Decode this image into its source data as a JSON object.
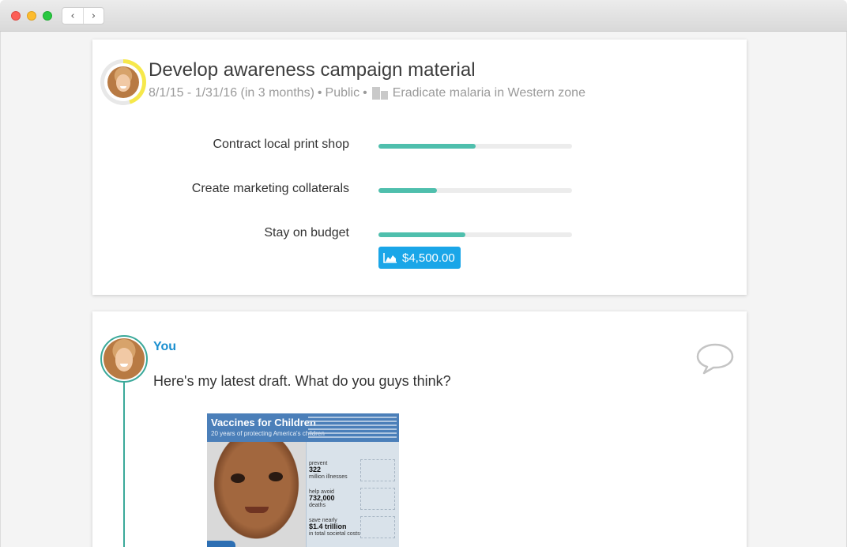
{
  "window": {
    "back_icon": "‹",
    "forward_icon": "›"
  },
  "goal": {
    "title": "Develop awareness campaign material",
    "dates": "8/1/15 - 1/31/16 (in 3 months)",
    "separator": "•",
    "visibility": "Public",
    "parent_goal": "Eradicate malaria in Western zone",
    "progress": 0.45,
    "colors": {
      "progress_ring": "#f6e84b",
      "bar_fill": "#4fbfad",
      "budget_badge": "#1aa6e8"
    },
    "key_results": [
      {
        "label": "Contract local print shop",
        "progress": 0.5
      },
      {
        "label": "Create marketing collaterals",
        "progress": 0.3
      },
      {
        "label": "Stay on budget",
        "progress": 0.45
      }
    ],
    "budget": "$4,500.00"
  },
  "post": {
    "author": "You",
    "message": "Here's my latest draft. What do you guys think?",
    "attachment": {
      "title": "Vaccines for Children",
      "subtitle": "20 years of protecting America's children",
      "stats": [
        {
          "pre": "prevent",
          "value": "322",
          "post": "million illnesses"
        },
        {
          "pre": "help avoid",
          "value": "732,000",
          "post": "deaths"
        },
        {
          "pre": "save nearly",
          "value": "$1.4 trillion",
          "post": "in total societal costs"
        }
      ]
    }
  }
}
